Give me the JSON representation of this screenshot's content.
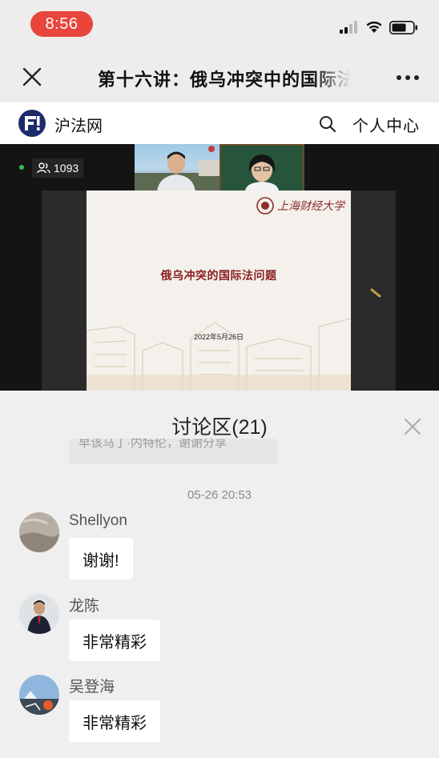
{
  "status_bar": {
    "time": "8:56"
  },
  "title_bar": {
    "title": "第十六讲：俄乌冲突中的国际法问题"
  },
  "site_header": {
    "site_name": "沪法网",
    "user_center": "个人中心"
  },
  "live": {
    "viewer_count": "1093",
    "slide": {
      "university": "上海财经大学",
      "title": "俄乌冲突的国际法问题",
      "date": "2022年5月26日"
    }
  },
  "discussion": {
    "title": "讨论区(21)",
    "previous_message": "早该马丁·内特伦，谢谢分享",
    "timestamp": "05-26 20:53",
    "messages": [
      {
        "sender": "Shellyon",
        "text": "谢谢!"
      },
      {
        "sender": "龙陈",
        "text": "非常精彩"
      },
      {
        "sender": "吴登海",
        "text": "非常精彩"
      }
    ]
  },
  "colors": {
    "time_pill": "#e8453c",
    "slide_title": "#8a1e1e",
    "live_dot": "#2fbf4a"
  }
}
